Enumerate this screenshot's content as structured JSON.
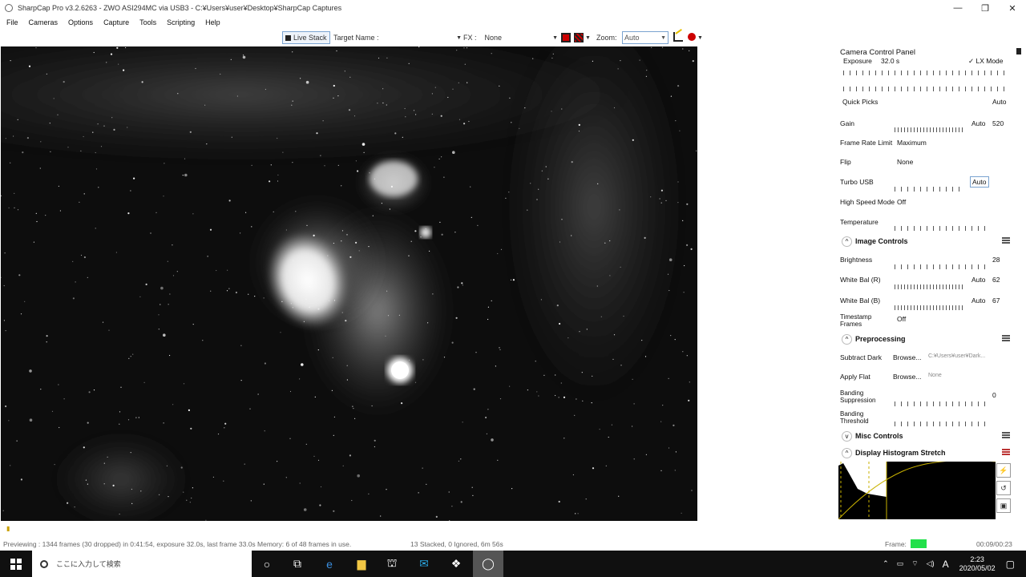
{
  "window": {
    "title": "SharpCap Pro v3.2.6263 - ZWO ASI294MC via USB3 - C:¥Users¥user¥Desktop¥SharpCap Captures",
    "minimize": "—",
    "maximize": "❐",
    "close": "✕"
  },
  "menu": [
    "File",
    "Cameras",
    "Options",
    "Capture",
    "Tools",
    "Scripting",
    "Help"
  ],
  "toolbar": {
    "live_stack": "Live Stack",
    "target_label": "Target Name :",
    "fx_label": "FX :",
    "fx_value": "None",
    "zoom_label": "Zoom:",
    "zoom_value": "Auto"
  },
  "panel": {
    "title": "Camera Control Panel",
    "exposure_label": "Exposure",
    "exposure_value": "32.0 s",
    "lx_mode": "✓ LX Mode",
    "quick_picks": "Quick Picks",
    "quick_picks_value": "Auto",
    "gain_label": "Gain",
    "gain_auto": "Auto",
    "gain_value": "520",
    "frame_rate_label": "Frame Rate Limit",
    "frame_rate_value": "Maximum",
    "flip_label": "Flip",
    "flip_value": "None",
    "turbo_label": "Turbo USB",
    "turbo_value": "Auto",
    "high_speed_label": "High Speed Mode",
    "high_speed_value": "Off",
    "temperature_label": "Temperature",
    "image_controls": "Image Controls",
    "brightness_label": "Brightness",
    "brightness_value": "28",
    "wb_r_label": "White Bal (R)",
    "wb_r_auto": "Auto",
    "wb_r_value": "62",
    "wb_b_label": "White Bal (B)",
    "wb_b_auto": "Auto",
    "wb_b_value": "67",
    "timestamp_label_1": "Timestamp",
    "timestamp_label_2": "Frames",
    "timestamp_value": "Off",
    "preprocessing": "Preprocessing",
    "subtract_dark_label": "Subtract Dark",
    "subtract_dark_browse": "Browse...",
    "subtract_dark_path": "C:¥Users¥user¥Dark...",
    "apply_flat_label": "Apply Flat",
    "apply_flat_browse": "Browse...",
    "apply_flat_path": "None",
    "banding_supp_1": "Banding",
    "banding_supp_2": "Suppression",
    "banding_supp_value": "0",
    "banding_thr_1": "Banding",
    "banding_thr_2": "Threshold",
    "misc_controls": "Misc Controls",
    "display_histogram": "Display Histogram Stretch"
  },
  "status": {
    "previewing": "Previewing : 1344 frames (30 dropped) in 0:41:54, exposure 32.0s, last frame 33.0s  Memory: 6 of 48 frames in use.",
    "stacked": "13 Stacked, 0 Ignored, 6m 56s",
    "frame_label": "Frame:",
    "time": "00:09/00:23"
  },
  "taskbar": {
    "search_placeholder": "ここに入力して検索",
    "time": "2:23",
    "date": "2020/05/02",
    "ime": "A"
  }
}
